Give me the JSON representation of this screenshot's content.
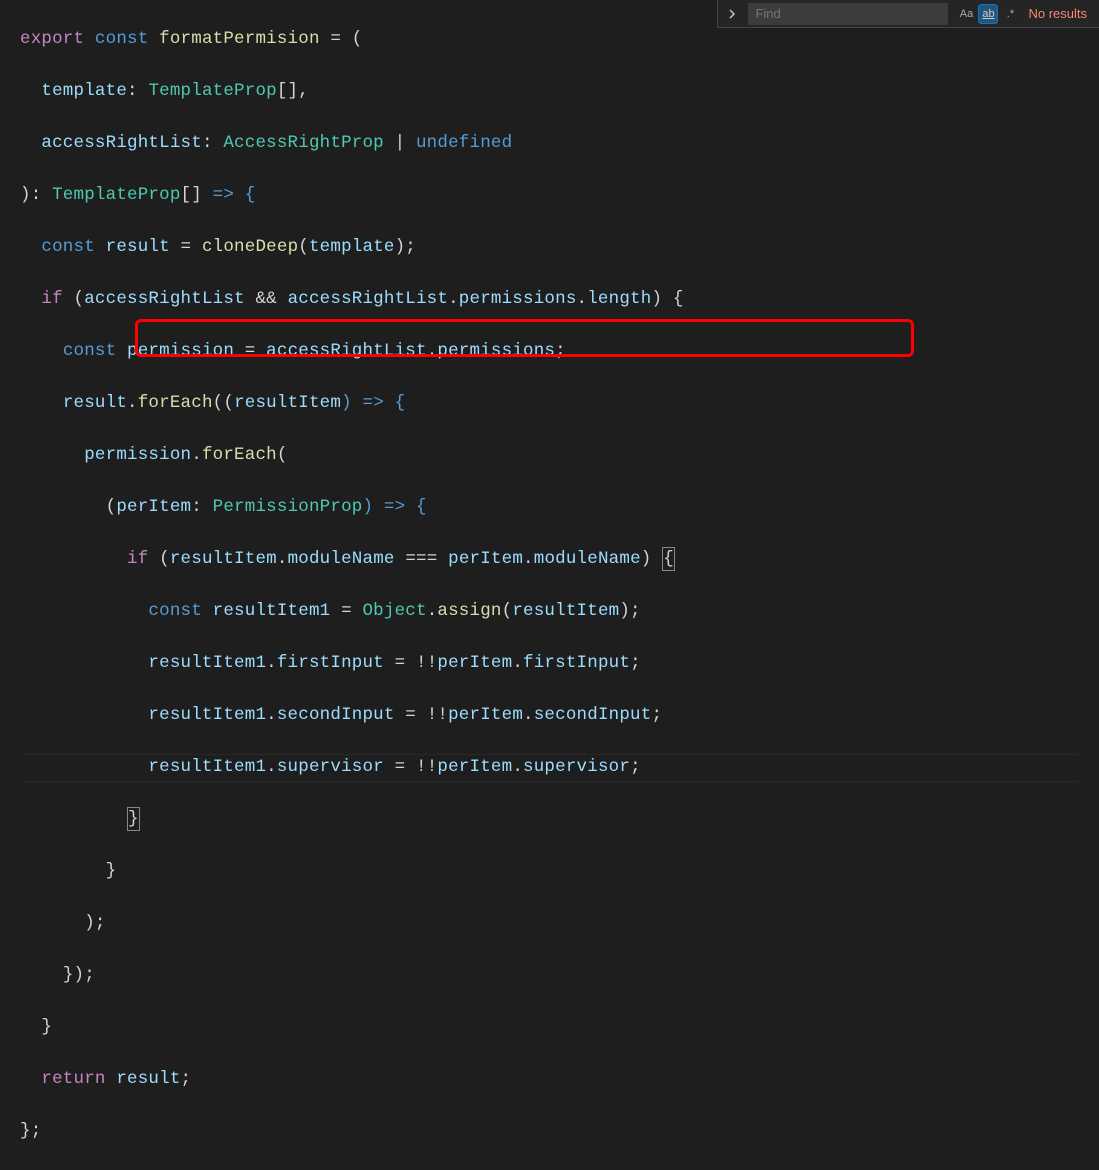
{
  "find": {
    "placeholder": "Find",
    "matchCase": "Aa",
    "matchWord": "ab",
    "regex": ".*",
    "noResults": "No results"
  },
  "code": {
    "l1": {
      "export": "export",
      "const": "const",
      "name": "formatPermision",
      "eq": " = ("
    },
    "l2": {
      "p1": "template",
      "col": ":",
      "t1": "TemplateProp",
      "brk": "[],"
    },
    "l3": {
      "p1": "accessRightList",
      "col": ":",
      "t1": "AccessRightProp",
      "pipe": "|",
      "undef": "undefined"
    },
    "l4": {
      "close": "):",
      "t1": "TemplateProp",
      "brk": "[]",
      "arrow": " => {"
    },
    "l5": {
      "const": "const",
      "v": "result",
      "eq": " = ",
      "fn": "cloneDeep",
      "arg": "template",
      "end": ");"
    },
    "l6": {
      "if": "if",
      "open": "(",
      "v1": "accessRightList",
      "and": "&&",
      "v2": "accessRightList",
      "dot": ".",
      "p1": "permissions",
      "p2": "length",
      "close": ") {"
    },
    "l7": {
      "const": "const",
      "v": "permission",
      "eq": " = ",
      "o": "accessRightList",
      "dot": ".",
      "p": "permissions",
      "end": ";"
    },
    "l8": {
      "o": "result",
      "fn": "forEach",
      "arg": "resultItem",
      "arrow": ") => {"
    },
    "l9": {
      "o": "permission",
      "fn": "forEach",
      "open": "("
    },
    "l10": {
      "open": "(",
      "arg": "perItem",
      "col": ":",
      "t": "PermissionProp",
      "close": ") => {"
    },
    "l11": {
      "if": "if",
      "open": "(",
      "v1": "resultItem",
      "p1": "moduleName",
      "eq": "===",
      "v2": "perItem",
      "p2": "moduleName",
      "close": ")",
      "brace": "{"
    },
    "l12": {
      "const": "const",
      "v": "resultItem1",
      "eq": " = ",
      "obj": "Object",
      "fn": "assign",
      "arg": "resultItem",
      "end": ");"
    },
    "l13": {
      "o": "resultItem1",
      "p": "firstInput",
      "eq": " = !!",
      "o2": "perItem",
      "p2": "firstInput",
      "end": ";"
    },
    "l14": {
      "o": "resultItem1",
      "p": "secondInput",
      "eq": " = !!",
      "o2": "perItem",
      "p2": "secondInput",
      "end": ";"
    },
    "l15": {
      "o": "resultItem1",
      "p": "supervisor",
      "eq": " = !!",
      "o2": "perItem",
      "p2": "supervisor",
      "end": ";"
    },
    "l16": {
      "brace": "}"
    },
    "l17": {
      "brace": "}"
    },
    "l18": {
      "end": ");"
    },
    "l19": {
      "end": "});"
    },
    "l20": {
      "brace": "}"
    },
    "l21": {
      "return": "return",
      "v": "result",
      "end": ";"
    },
    "l22": {
      "end": "};"
    }
  },
  "highlight": {}
}
